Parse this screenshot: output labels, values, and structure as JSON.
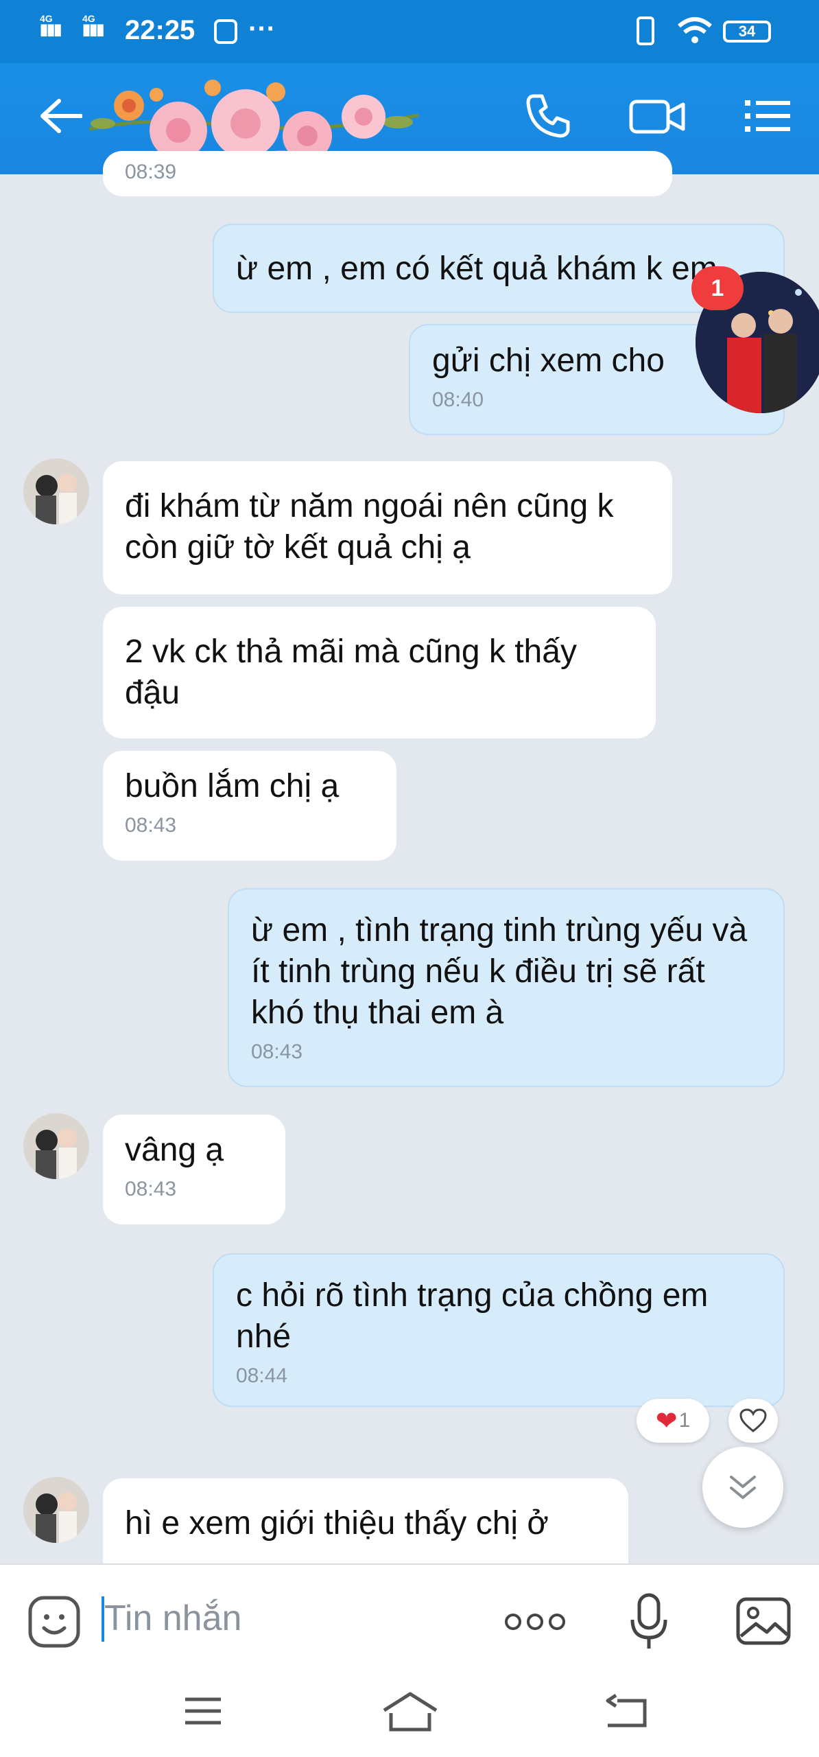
{
  "status_bar": {
    "network1": "4G",
    "network2": "4G",
    "time": "22:25",
    "more": "···",
    "battery": "34"
  },
  "header": {
    "back_icon": "arrow-left-icon",
    "call_icon": "phone-icon",
    "video_icon": "video-camera-icon",
    "menu_icon": "list-menu-icon"
  },
  "messages": [
    {
      "side": "in",
      "text": "08:39"
    },
    {
      "side": "out",
      "text": "ừ em , em có kết quả khám k em"
    },
    {
      "side": "out",
      "text": "gửi chị xem cho",
      "time": "08:40"
    },
    {
      "side": "in",
      "text": "đi khám từ năm ngoái nên cũng k còn giữ  tờ  kết quả chị ạ"
    },
    {
      "side": "in",
      "text": "2 vk ck thả mãi mà cũng k thấy đậu"
    },
    {
      "side": "in",
      "text": "buồn lắm chị ạ",
      "time": "08:43"
    },
    {
      "side": "out",
      "text": "ừ em , tình trạng tinh trùng yếu và ít tinh trùng nếu k điều trị sẽ rất khó thụ thai em à",
      "time": "08:43"
    },
    {
      "side": "in",
      "text": "vâng ạ",
      "time": "08:43"
    },
    {
      "side": "out",
      "text": "c hỏi rõ tình trạng của chồng em nhé",
      "time": "08:44"
    },
    {
      "side": "in",
      "text": "hì e xem giới thiệu thấy chị ở"
    }
  ],
  "reaction": {
    "icon": "heart-icon",
    "count": "1"
  },
  "chathead_badge": "1",
  "input": {
    "placeholder": "Tin nhắn"
  },
  "colors": {
    "header": "#1a86df",
    "status_bar": "#0f82d6",
    "out_bubble": "#d7ecfb",
    "in_bubble": "#ffffff",
    "background": "#e3e8ee",
    "badge": "#ef3d3d"
  }
}
